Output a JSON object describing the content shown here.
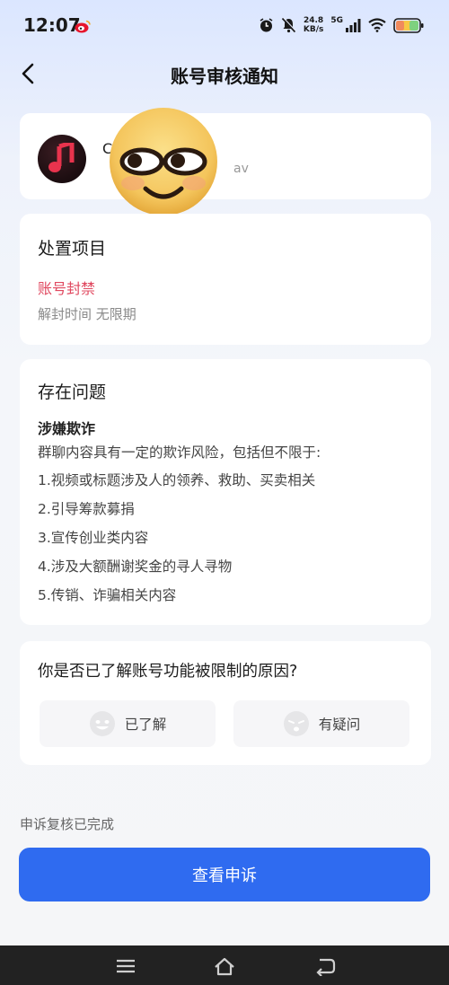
{
  "status_bar": {
    "time": "12:07",
    "net_speed_value": "24.8",
    "net_speed_unit": "KB/s",
    "network": "5G",
    "icons": [
      "weibo-icon",
      "alarm-icon",
      "mute-icon",
      "signal-icon",
      "wifi-icon",
      "battery-icon"
    ]
  },
  "header": {
    "title": "账号审核通知"
  },
  "account": {
    "name_partial": "C",
    "sub_partial": "av"
  },
  "action_card": {
    "title": "处置项目",
    "action": "账号封禁",
    "unban_label": "解封时间 无限期"
  },
  "issues_card": {
    "title": "存在问题",
    "issue_name": "涉嫌欺诈",
    "description": "群聊内容具有一定的欺诈风险，包括但不限于:",
    "items": [
      "1.视频或标题涉及人的领养、救助、买卖相关",
      "2.引导筹款募捐",
      "3.宣传创业类内容",
      "4.涉及大额酬谢奖金的寻人寻物",
      "5.传销、诈骗相关内容"
    ]
  },
  "question_card": {
    "question": "你是否已了解账号功能被限制的原因?",
    "option_understood": "已了解",
    "option_doubt": "有疑问"
  },
  "appeal": {
    "status": "申诉复核已完成",
    "button_label": "查看申诉"
  },
  "colors": {
    "accent": "#2f6bf0",
    "ban_red": "#e0485f",
    "nav_bar": "#222222"
  }
}
